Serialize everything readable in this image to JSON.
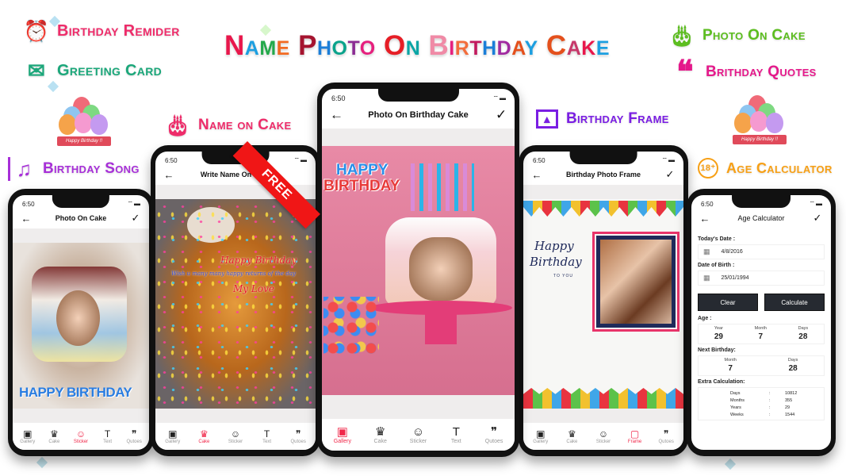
{
  "headline": {
    "words": [
      {
        "text": "Name",
        "color": "#e8174b"
      },
      {
        "text": "Photo",
        "color": "#a5142f"
      },
      {
        "text": "On",
        "color": "#e61e26"
      },
      {
        "text": "Birthday",
        "color": "#f08aa6"
      },
      {
        "text": "Cake",
        "color": "#e4501c"
      }
    ],
    "letter_colors": [
      "#e8174b",
      "#1d9fe0",
      "#24a94b",
      "#f26a22",
      "#a5142f",
      "#1b7ed8",
      "#0aa38c",
      "#8b2c93",
      "#e6207e",
      "#e61e26",
      "#0aa5a5",
      "#f08aa6",
      "#e6207e",
      "#f36d3c",
      "#c21a5e",
      "#1b7ed8",
      "#a12aa0",
      "#e4501c",
      "#1d9fe0",
      "#24a94b",
      "#c7386a"
    ],
    "text": "Name Photo On Birthday Cake"
  },
  "features": {
    "birthday_reminder": {
      "label": "Birthday Remider",
      "icon": "alarm-clock-icon",
      "color": "#ee2c6a"
    },
    "greeting_card": {
      "label": "Greeting Card",
      "icon": "greeting-card-icon",
      "color": "#1ba77a"
    },
    "name_on_cake": {
      "label": "Name on Cake",
      "icon": "cake-icon",
      "color": "#ee2c6a"
    },
    "birthday_song": {
      "label": "Birthday Song",
      "icon": "music-note-icon",
      "color": "#a72fd8"
    },
    "photo_on_cake": {
      "label": "Photo On Cake",
      "icon": "cake-icon",
      "color": "#5cbd1f"
    },
    "birthday_quotes": {
      "label": "Brithday Quotes",
      "icon": "quote-icon",
      "color": "#e5198b"
    },
    "birthday_frame": {
      "label": "Birthday Frame",
      "icon": "image-frame-icon",
      "color": "#7a1ee3"
    },
    "age_calculator": {
      "label": "Age Calculator",
      "icon": "age-18-plus-icon",
      "color": "#f7a016"
    }
  },
  "balloon_badge": {
    "text": "Happy Birthday !!"
  },
  "free_ribbon": "FREE",
  "phones": {
    "photo_on_cake": {
      "time": "6:50",
      "title": "Photo On Cake",
      "canvas_text": "HAPPY BIRTHDAY",
      "tabs": [
        {
          "label": "Gallery",
          "icon": "▣"
        },
        {
          "label": "Cake",
          "icon": "♛"
        },
        {
          "label": "Sticker",
          "icon": "☺"
        },
        {
          "label": "Text",
          "icon": "T"
        },
        {
          "label": "Qutoes",
          "icon": "❞"
        }
      ],
      "active_tab": "Sticker"
    },
    "write_name": {
      "time": "6:50",
      "title": "Write Name On Cake",
      "canvas_lines": [
        "Happy Birthday",
        "Wish u many many happy returns of the day",
        "My Love"
      ],
      "tabs": [
        {
          "label": "Gallery",
          "icon": "▣"
        },
        {
          "label": "Cake",
          "icon": "♛"
        },
        {
          "label": "Sticker",
          "icon": "☺"
        },
        {
          "label": "Text",
          "icon": "T"
        },
        {
          "label": "Qutoes",
          "icon": "❞"
        }
      ],
      "active_tab": "Cake"
    },
    "photo_on_birthday_cake": {
      "time": "6:50",
      "title": "Photo On Birthday Cake",
      "canvas_text": [
        "HAPPY",
        "BIRTHDAY"
      ],
      "tabs": [
        {
          "label": "Gallery",
          "icon": "▣"
        },
        {
          "label": "Cake",
          "icon": "♛"
        },
        {
          "label": "Sticker",
          "icon": "☺"
        },
        {
          "label": "Text",
          "icon": "T"
        },
        {
          "label": "Qutoes",
          "icon": "❞"
        }
      ],
      "active_tab": "Gallery"
    },
    "birthday_photo_frame": {
      "time": "6:50",
      "title": "Birthday Photo Frame",
      "canvas_text": [
        "Happy",
        "Birthday",
        "TO YOU"
      ],
      "tabs": [
        {
          "label": "Gallery",
          "icon": "▣"
        },
        {
          "label": "Cake",
          "icon": "♛"
        },
        {
          "label": "Sticker",
          "icon": "☺"
        },
        {
          "label": "Frame",
          "icon": "▢"
        },
        {
          "label": "Qutoes",
          "icon": "❞"
        }
      ],
      "active_tab": "Frame"
    },
    "age_calculator": {
      "time": "6:50",
      "title": "Age Calculator",
      "todays_date_label": "Today's Date :",
      "todays_date": "4/8/2016",
      "dob_label": "Date of Birth :",
      "dob": "25/01/1994",
      "clear_label": "Clear",
      "calculate_label": "Calculate",
      "age_label": "Age :",
      "age": {
        "year_label": "Year",
        "year": "29",
        "month_label": "Month",
        "month": "7",
        "days_label": "Days",
        "days": "28"
      },
      "next_birthday_label": "Next Birthday:",
      "next_birthday": {
        "month_label": "Month",
        "month": "7",
        "days_label": "Days",
        "days": "28"
      },
      "extra_label": "Extra Calculation:",
      "extra": [
        {
          "k": "Days",
          "v": "10812"
        },
        {
          "k": "Months",
          "v": "355"
        },
        {
          "k": "Years",
          "v": "29"
        },
        {
          "k": "Weeks",
          "v": "1544"
        }
      ]
    }
  },
  "colors": {
    "accent": "#f0284a",
    "dark_button": "#262a31",
    "canvas_bg": "#efeded"
  }
}
